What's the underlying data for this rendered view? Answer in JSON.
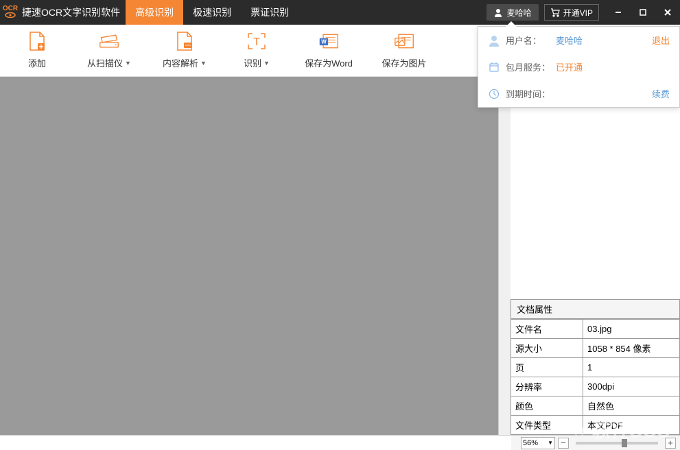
{
  "titlebar": {
    "app_title": "捷速OCR文字识别软件",
    "tabs": [
      {
        "label": "高级识别",
        "active": true
      },
      {
        "label": "极速识别",
        "active": false
      },
      {
        "label": "票证识别",
        "active": false
      }
    ],
    "user_button": "麦哈哈",
    "vip_button": "开通VIP"
  },
  "toolbar": {
    "add": "添加",
    "scanner": "从扫描仪",
    "parse": "内容解析",
    "recognize": "识别",
    "save_word": "保存为Word",
    "save_image": "保存为图片"
  },
  "user_popup": {
    "username_label": "用户名：",
    "username_value": "麦哈哈",
    "logout": "退出",
    "service_label": "包月服务：",
    "service_value": "已开通",
    "expiry_label": "到期时间：",
    "expiry_value": "",
    "renew": "续费"
  },
  "properties": {
    "header": "文档属性",
    "rows": [
      {
        "key": "文件名",
        "value": "03.jpg"
      },
      {
        "key": "源大小",
        "value": "1058 * 854 像素"
      },
      {
        "key": "页",
        "value": "1"
      },
      {
        "key": "分辨率",
        "value": "300dpi"
      },
      {
        "key": "颜色",
        "value": "自然色"
      },
      {
        "key": "文件类型",
        "value": "本文PDF"
      }
    ]
  },
  "zoom": {
    "value": "56%",
    "minus": "−",
    "plus": "+"
  },
  "watermark": "软件SOS"
}
